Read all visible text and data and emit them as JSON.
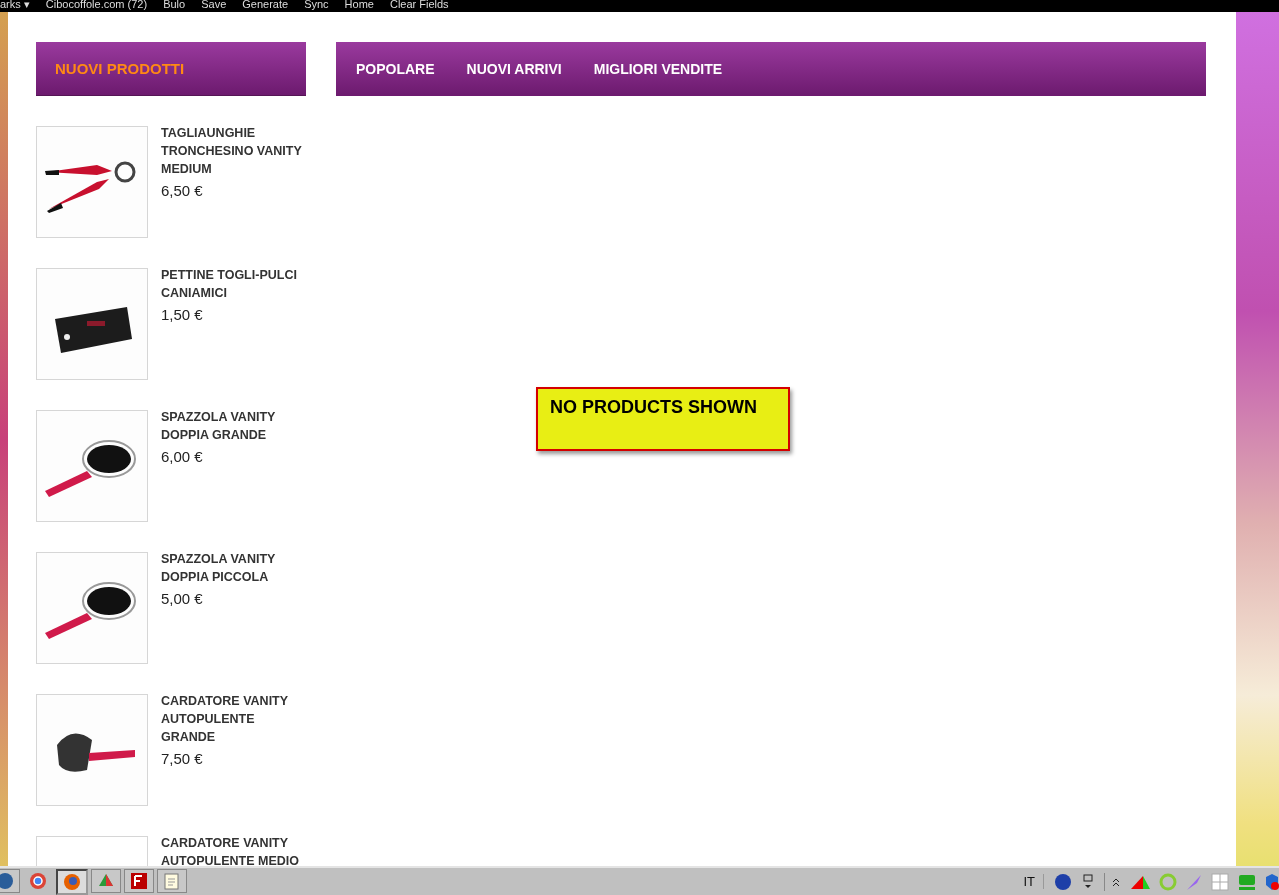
{
  "browser_toolbar": {
    "items": [
      "arks ▾",
      "Cibocoffole.com (72)",
      "Bulo",
      "Save",
      "Generate",
      "Sync",
      "Home",
      "Clear Fields"
    ]
  },
  "sidebar": {
    "title": "NUOVI PRODOTTI",
    "products": [
      {
        "name": "TAGLIAUNGHIE TRONCHESINO VANITY MEDIUM",
        "price": "6,50 €"
      },
      {
        "name": "PETTINE TOGLI-PULCI CANIAMICI",
        "price": "1,50 €"
      },
      {
        "name": "SPAZZOLA VANITY DOPPIA GRANDE",
        "price": "6,00 €"
      },
      {
        "name": "SPAZZOLA VANITY DOPPIA PICCOLA",
        "price": "5,00 €"
      },
      {
        "name": "CARDATORE VANITY AUTOPULENTE GRANDE",
        "price": "7,50 €"
      },
      {
        "name": "CARDATORE VANITY AUTOPULENTE MEDIO"
      }
    ]
  },
  "tabs": [
    "POPOLARE",
    "NUOVI ARRIVI",
    "MIGLIORI VENDITE"
  ],
  "notice": "NO PRODUCTS SHOWN",
  "taskbar": {
    "language": "IT"
  }
}
